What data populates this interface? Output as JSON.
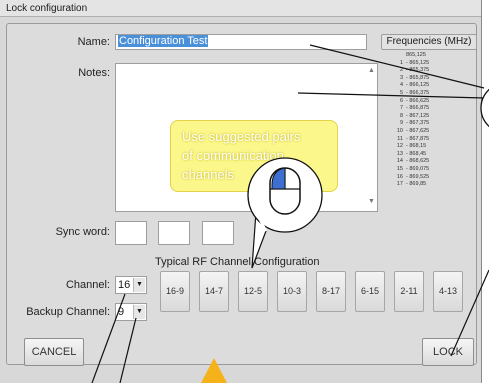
{
  "window": {
    "title": "Lock configuration"
  },
  "form": {
    "name_label": "Name:",
    "name_value": "Configuration Test",
    "notes_label": "Notes:",
    "sync_label": "Sync word:",
    "channel_label": "Channel:",
    "channel_value": "16",
    "backup_label": "Backup Channel:",
    "backup_value": "9"
  },
  "frequencies": {
    "header": "Frequencies (MHz)",
    "items": [
      {
        "n": "",
        "f": "865,125"
      },
      {
        "n": "1",
        "f": "- 865,125"
      },
      {
        "n": "2",
        "f": "- 865,375"
      },
      {
        "n": "3",
        "f": "- 865,875"
      },
      {
        "n": "4",
        "f": "- 866,125"
      },
      {
        "n": "5",
        "f": "- 866,375"
      },
      {
        "n": "6",
        "f": "- 866,625"
      },
      {
        "n": "7",
        "f": "- 866,875"
      },
      {
        "n": "8",
        "f": "- 867,125"
      },
      {
        "n": "9",
        "f": "- 867,375"
      },
      {
        "n": "10",
        "f": "- 867,625"
      },
      {
        "n": "11",
        "f": "- 867,875"
      },
      {
        "n": "12",
        "f": "- 868,15"
      },
      {
        "n": "13",
        "f": "- 868,45"
      },
      {
        "n": "14",
        "f": "- 868,625"
      },
      {
        "n": "15",
        "f": "- 869,075"
      },
      {
        "n": "16",
        "f": "- 869,525"
      },
      {
        "n": "17",
        "f": "- 869,85"
      }
    ]
  },
  "channel_config": {
    "title": "Typical RF Channel Configuration",
    "pairs": [
      "16-9",
      "14-7",
      "12-5",
      "10-3",
      "8-17",
      "6-15",
      "2-11",
      "4-13"
    ]
  },
  "buttons": {
    "cancel": "CANCEL",
    "lock": "LOCK"
  },
  "callout": {
    "lines": [
      "Use suggested pairs",
      "of communication",
      "channels"
    ]
  },
  "icons": {
    "mouse": "mouse-icon",
    "pointer": "pointer-arrow-icon"
  },
  "colors": {
    "callout_bg": "#fcf78a",
    "pointer": "#f6b21b",
    "selection": "#4a90d9"
  }
}
